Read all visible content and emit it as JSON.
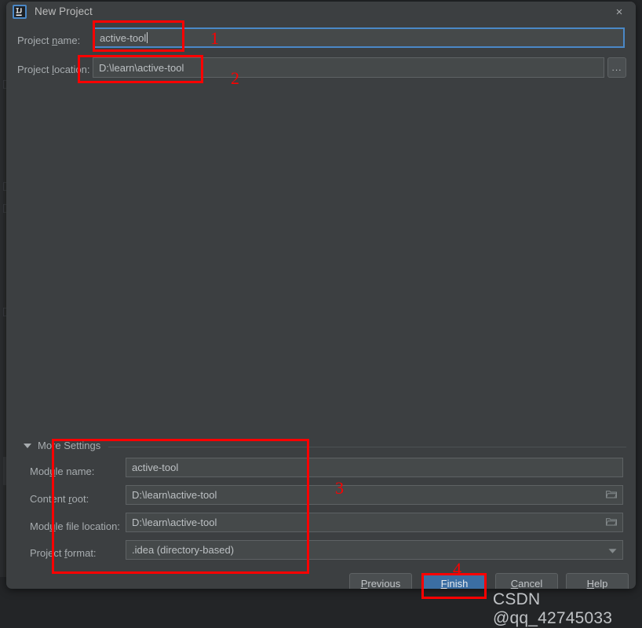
{
  "window": {
    "title": "New Project",
    "app_icon": "intellij-idea-icon",
    "close_label": "×"
  },
  "form": {
    "project_name": {
      "label_pre": "Project ",
      "label_mnemonic": "n",
      "label_post": "ame:",
      "value": "active-tool",
      "focused": true
    },
    "project_location": {
      "label_pre": "Project ",
      "label_mnemonic": "l",
      "label_post": "ocation:",
      "value": "D:\\learn\\active-tool",
      "browse_label": "..."
    }
  },
  "more_settings": {
    "title": "More Settings",
    "expanded": true,
    "rows": [
      {
        "label_pre": "Mod",
        "label_mnemonic": "u",
        "label_post": "le name:",
        "value": "active-tool",
        "icon": "none"
      },
      {
        "label_pre": "Content ",
        "label_mnemonic": "r",
        "label_post": "oot:",
        "value": "D:\\learn\\active-tool",
        "icon": "folder-icon"
      },
      {
        "label_pre": "Mod",
        "label_mnemonic": "u",
        "label_post": "le file location:",
        "value": "D:\\learn\\active-tool",
        "icon": "folder-icon"
      },
      {
        "label_pre": "Project ",
        "label_mnemonic": "f",
        "label_post": "ormat:",
        "value": ".idea (directory-based)",
        "icon": "chevron-down-icon"
      }
    ]
  },
  "buttons": {
    "previous": {
      "pre": "",
      "mnemonic": "P",
      "post": "revious"
    },
    "finish": {
      "pre": "",
      "mnemonic": "F",
      "post": "inish",
      "primary": true
    },
    "cancel": {
      "pre": "",
      "mnemonic": "C",
      "post": "ancel"
    },
    "help": {
      "pre": "",
      "mnemonic": "H",
      "post": "elp"
    }
  },
  "annotations": {
    "numbers": [
      "1",
      "2",
      "3",
      "4"
    ],
    "color": "#fe0000"
  },
  "watermark": "CSDN @qq_42745033",
  "colors": {
    "dialog_bg": "#3c3f41",
    "field_bg": "#45494a",
    "accent_blue": "#4a88c7",
    "primary_button": "#3b6ea3",
    "annotation_red": "#fe0000",
    "desktop_bg": "#232527"
  }
}
